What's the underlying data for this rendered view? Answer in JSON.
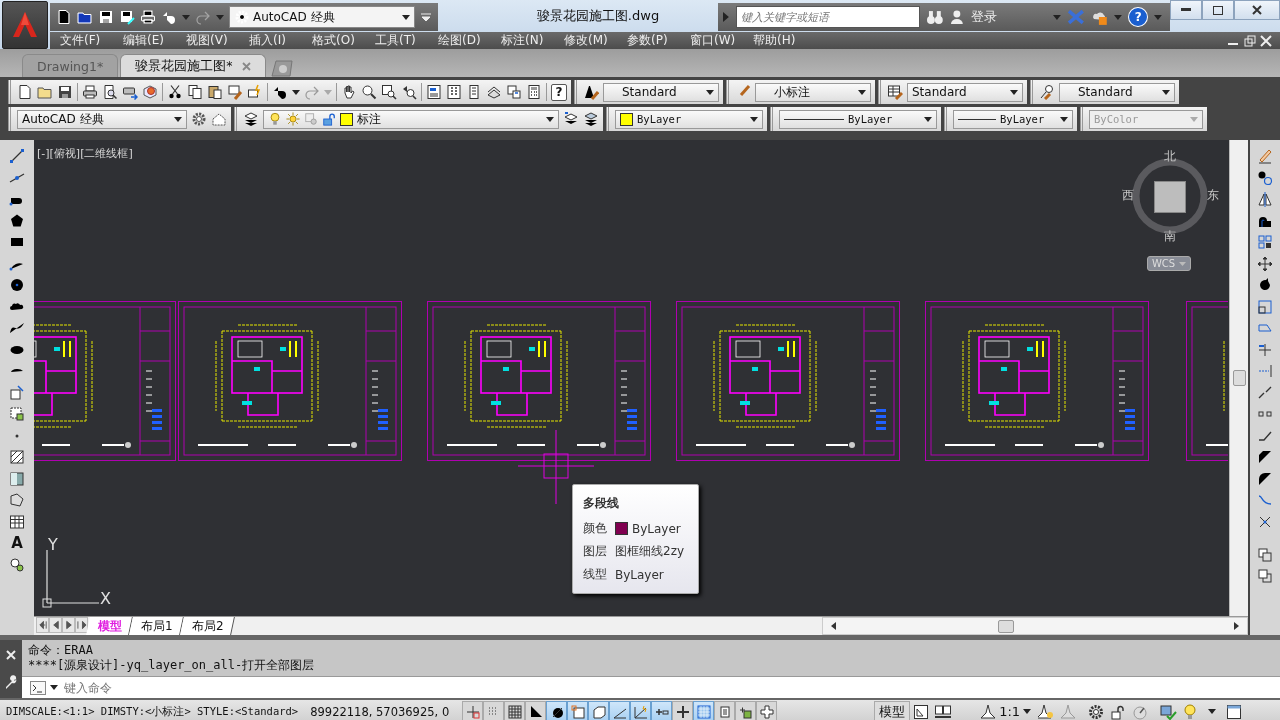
{
  "title_bar": {
    "workspace": "AutoCAD 经典",
    "title": "骏景花园施工图.dwg",
    "search_placeholder": "键入关键字或短语",
    "sign_in": "登录",
    "help": "?"
  },
  "menu": [
    "文件(F)",
    "编辑(E)",
    "视图(V)",
    "插入(I)",
    "格式(O)",
    "工具(T)",
    "绘图(D)",
    "标注(N)",
    "修改(M)",
    "参数(P)",
    "窗口(W)",
    "帮助(H)"
  ],
  "doc_tabs": [
    {
      "label": "Drawing1*",
      "selected": false
    },
    {
      "label": "骏景花园施工图*",
      "selected": true
    }
  ],
  "standard_toolbar": {
    "help": "?"
  },
  "styles_toolbar": {
    "text_style": "Standard",
    "dim_style": "小标注",
    "table_style": "Standard",
    "mleader_style": "Standard"
  },
  "layers_toolbar": {
    "workspace": "AutoCAD 经典",
    "layer": {
      "name": "标注",
      "color": "#ffff00"
    }
  },
  "properties_toolbar": {
    "color_control": {
      "value": "ByLayer",
      "color": "#ffff00"
    },
    "linetype": "ByLayer",
    "lineweight": "ByLayer",
    "plot_style": "ByColor",
    "plot_style_disabled": true
  },
  "draw_toolbar": {
    "text_tool": "A"
  },
  "viewport": {
    "label": "[-][俯视][二维线框]",
    "north": "北",
    "south": "南",
    "west": "西",
    "east": "东",
    "ucs_menu": "WCS",
    "axis_x": "X",
    "axis_y": "Y"
  },
  "tooltip": {
    "title": "多段线",
    "rows": [
      {
        "label": "颜色",
        "value": "ByLayer",
        "color": "#800050"
      },
      {
        "label": "图层",
        "value": "图框细线2zy"
      },
      {
        "label": "线型",
        "value": "ByLayer"
      }
    ]
  },
  "layout_tabs": [
    {
      "label": "模型",
      "selected": true
    },
    {
      "label": "布局1",
      "selected": false
    },
    {
      "label": "布局2",
      "selected": false
    }
  ],
  "command_history": [
    "命令：ERAA",
    "****[源泉设计]-yq_layer_on_all-打开全部图层"
  ],
  "command_line": {
    "placeholder": "键入命令"
  },
  "status_bar": {
    "settings": "DIMSCALE:<1:1> DIMSTY:<小标注> STYLE:<Standard>",
    "coordinates": "89922118, 57036925, 0",
    "toggles": [
      {
        "on": false
      },
      {
        "on": false
      },
      {
        "on": false
      },
      {
        "on": false
      },
      {
        "on": true
      },
      {
        "on": true
      },
      {
        "on": true
      },
      {
        "on": true
      },
      {
        "on": true
      },
      {
        "on": true
      },
      {
        "on": false
      },
      {
        "on": true
      },
      {
        "on": false
      },
      {
        "on": false
      },
      {
        "on": false
      }
    ],
    "space": "模型",
    "scale": "1:1"
  }
}
